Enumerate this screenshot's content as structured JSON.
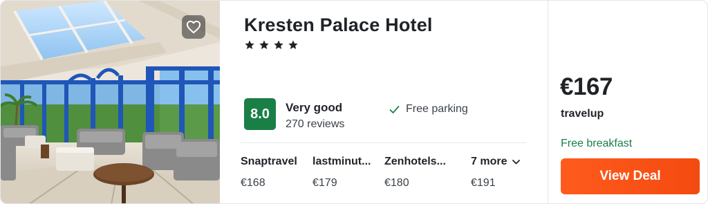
{
  "hotel": {
    "name": "Kresten Palace Hotel",
    "stars": 4
  },
  "rating": {
    "score": "8.0",
    "label": "Very good",
    "reviews": "270 reviews",
    "color": "#1a7f47"
  },
  "amenities": [
    {
      "icon": "check-icon",
      "label": "Free parking"
    }
  ],
  "providers": [
    {
      "name": "Snaptravel",
      "price": "€168"
    },
    {
      "name": "lastminut...",
      "price": "€179"
    },
    {
      "name": "Zenhotels...",
      "price": "€180"
    }
  ],
  "more": {
    "label": "7 more",
    "price": "€191",
    "icon": "chevron-down-icon"
  },
  "deal": {
    "price": "€167",
    "provider": "travelup",
    "perk": "Free breakfast",
    "button_label": "View Deal",
    "button_color": "#ff5b1d"
  },
  "favorite_icon": "heart-icon"
}
